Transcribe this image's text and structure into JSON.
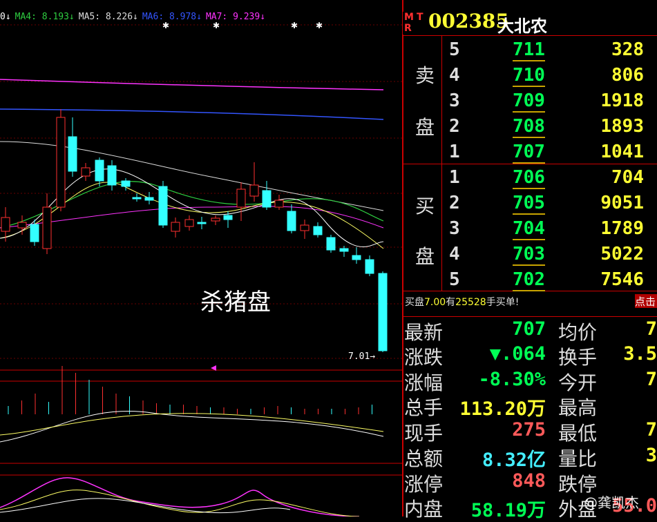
{
  "chart": {
    "ma_legend": [
      {
        "text": "0↓",
        "color": "#ffffff"
      },
      {
        "text": "MA4: 8.193↓",
        "color": "#2ecc40"
      },
      {
        "text": "MA5: 8.226↓",
        "color": "#dddddd"
      },
      {
        "text": "MA6: 8.978↓",
        "color": "#3355ff"
      },
      {
        "text": "MA7: 9.239↓",
        "color": "#ff33ff"
      }
    ],
    "overlay_text": "杀猪盘",
    "low_price_label": "7.01→"
  },
  "colors": {
    "up": "#ff3030",
    "down": "#33ffff",
    "frame": "#cc0000"
  },
  "stock": {
    "mtr_letters": [
      "M",
      "T",
      "R"
    ],
    "code": "002385",
    "name": "大北农"
  },
  "orderbook": {
    "sell_label_1": "卖",
    "sell_label_2": "盘",
    "buy_label_1": "买",
    "buy_label_2": "盘",
    "sell": [
      {
        "level": "5",
        "price": "711",
        "volume": "328"
      },
      {
        "level": "4",
        "price": "710",
        "volume": "806"
      },
      {
        "level": "3",
        "price": "709",
        "volume": "1918"
      },
      {
        "level": "2",
        "price": "708",
        "volume": "1893"
      },
      {
        "level": "1",
        "price": "707",
        "volume": "1041"
      }
    ],
    "buy": [
      {
        "level": "1",
        "price": "706",
        "volume": "704"
      },
      {
        "level": "2",
        "price": "705",
        "volume": "9051"
      },
      {
        "level": "3",
        "price": "704",
        "volume": "1789"
      },
      {
        "level": "4",
        "price": "703",
        "volume": "5022"
      },
      {
        "level": "5",
        "price": "702",
        "volume": "7546"
      }
    ]
  },
  "message": {
    "prefix": "买盘",
    "price": "7.00",
    "mid": "有",
    "count": "25528",
    "suffix": "手买单!",
    "button": "点击"
  },
  "quote": {
    "left": [
      {
        "label": "最新",
        "value": "707",
        "color": "green"
      },
      {
        "label": "涨跌",
        "value": "▼.064",
        "color": "green"
      },
      {
        "label": "涨幅",
        "value": "-8.30%",
        "color": "green"
      },
      {
        "label": "总手",
        "value": "113.20万",
        "color": "yellow"
      },
      {
        "label": "现手",
        "value": "275",
        "color": "red"
      },
      {
        "label": "总额",
        "value": "8.32亿",
        "color": "cyan"
      },
      {
        "label": "涨停",
        "value": "848",
        "color": "red"
      },
      {
        "label": "内盘",
        "value": "58.19万",
        "color": "green"
      }
    ],
    "right": [
      {
        "label": "均价",
        "value": "7",
        "color": "yellow"
      },
      {
        "label": "换手",
        "value": "3.5",
        "color": "yellow"
      },
      {
        "label": "今开",
        "value": "7",
        "color": "yellow"
      },
      {
        "label": "最高",
        "value": "",
        "color": "yellow"
      },
      {
        "label": "最低",
        "value": "7",
        "color": "yellow"
      },
      {
        "label": "量比",
        "value": "3",
        "color": "yellow"
      },
      {
        "label": "跌停",
        "value": "",
        "color": "green"
      },
      {
        "label": "外盘",
        "value": "55.0",
        "color": "red"
      }
    ]
  },
  "watermark": "@龚凯杰"
}
